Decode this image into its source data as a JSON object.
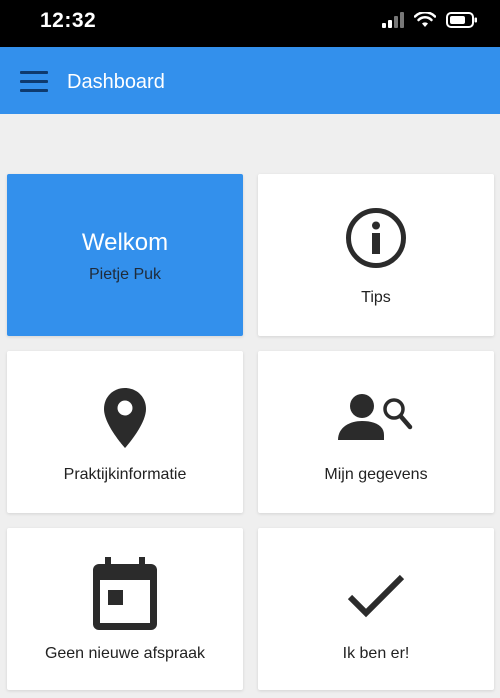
{
  "status_bar": {
    "time": "12:32"
  },
  "app_bar": {
    "title": "Dashboard"
  },
  "tiles": {
    "welcome": {
      "title": "Welkom",
      "name": "Pietje Puk"
    },
    "tips": {
      "label": "Tips",
      "icon": "info-icon"
    },
    "practice": {
      "label": "Praktijkinformatie",
      "icon": "location-pin-icon"
    },
    "profile": {
      "label": "Mijn gegevens",
      "icon": "person-search-icon"
    },
    "appointment": {
      "label": "Geen nieuwe afspraak",
      "icon": "calendar-icon"
    },
    "checkin": {
      "label": "Ik ben er!",
      "icon": "checkmark-icon"
    }
  },
  "colors": {
    "accent": "#3390ec",
    "icon": "#2b2b2b",
    "background": "#efefef"
  }
}
